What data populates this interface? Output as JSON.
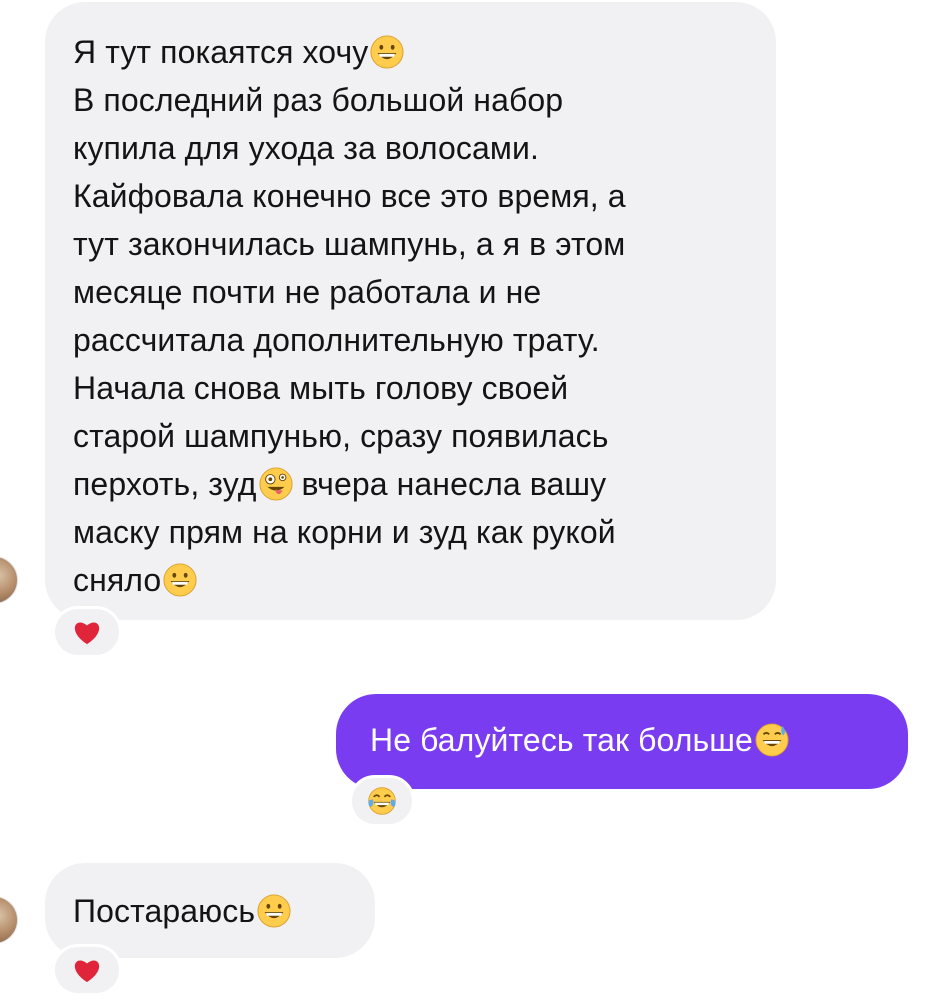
{
  "messages": {
    "incoming_1": {
      "lines": [
        "Я тут покаятся хочу",
        "В последний раз большой набор",
        "купила для ухода за волосами.",
        "Кайфовала конечно все это время, а",
        "тут закончилась шампунь, а я в этом",
        "месяце почти не работала и не",
        "рассчитала дополнительную трату.",
        "Начала снова мыть голову своей",
        "старой шампунью, сразу появилась",
        "перхоть, зуд",
        " вчера нанесла вашу",
        "маску прям на корни и зуд как рукой",
        "сняло"
      ],
      "reaction": "heart"
    },
    "outgoing_1": {
      "text": "Не балуйтесь так больше",
      "reaction": "laughing"
    },
    "incoming_2": {
      "text": "Постараюсь",
      "reaction": "heart"
    }
  },
  "colors": {
    "incoming_bubble": "#f1f1f3",
    "outgoing_bubble": "#7a3cf0",
    "heart": "#e0243a"
  },
  "icons": {
    "grin": "grinning-face-icon",
    "zany": "zany-face-icon",
    "sweat_smile": "grinning-sweat-icon",
    "heart": "heart-icon",
    "laughing": "tears-of-joy-icon"
  }
}
